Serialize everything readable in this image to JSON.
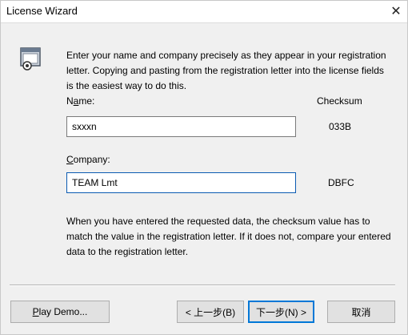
{
  "window": {
    "title": "License Wizard",
    "close_glyph": "✕"
  },
  "icon": {
    "name": "license-wizard-icon"
  },
  "intro_text": "Enter your name and company precisely as they appear in your registration letter.  Copying and pasting from the registration letter into the license fields is the easiest way to do this.",
  "labels": {
    "name_prefix": "N",
    "name_underlined": "a",
    "name_suffix": "me:",
    "company_underlined": "C",
    "company_suffix": "ompany:",
    "checksum": "Checksum"
  },
  "fields": {
    "name_value": "sxxxn",
    "name_checksum": "033B",
    "company_value": "TEAM Lmt",
    "company_checksum": "DBFC"
  },
  "outro_text": "When you have entered the requested data, the checksum value has to match the value in the registration letter.  If it does not, compare your entered data to the registration letter.",
  "buttons": {
    "play_demo_prefix": "",
    "play_demo_underlined": "P",
    "play_demo_suffix": "lay Demo...",
    "back": "< 上一步(B)",
    "next": "下一步(N) >",
    "cancel": "取消"
  }
}
